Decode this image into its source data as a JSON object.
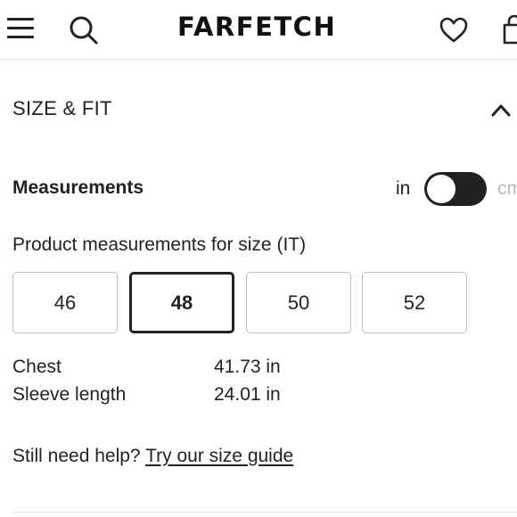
{
  "header": {
    "logo": "FARFETCH",
    "icons": [
      "menu-icon",
      "search-icon",
      "heart-icon",
      "shopping-bag-icon"
    ]
  },
  "section": {
    "title": "SIZE & FIT",
    "expanded": true,
    "icon": "chevron-up-icon"
  },
  "measurements": {
    "label": "Measurements",
    "unit_left": "in",
    "unit_right": "cm",
    "selected_unit": "in"
  },
  "size_selector": {
    "caption": "Product measurements for size (IT)",
    "sizes": [
      "46",
      "48",
      "50",
      "52"
    ],
    "selected": "48"
  },
  "measurement_rows": [
    {
      "label": "Chest",
      "value": "41.73 in"
    },
    {
      "label": "Sleeve length",
      "value": "24.01 in"
    }
  ],
  "help": {
    "text": "Still need help?",
    "link": "Try our size guide"
  },
  "colors": {
    "text": "#222222",
    "toggle_on": "#222222",
    "inactive_unit": "#b8b8b8",
    "border": "#bdbdbd"
  }
}
